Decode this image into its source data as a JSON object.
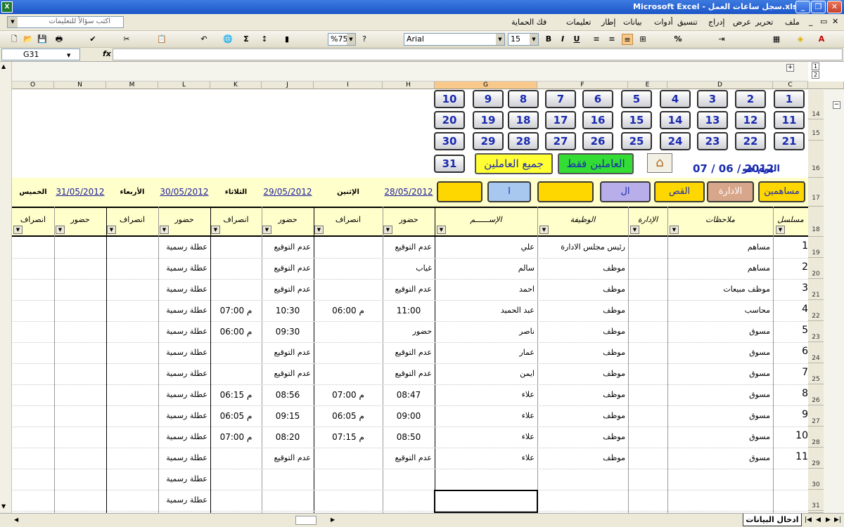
{
  "window": {
    "title": "Microsoft Excel - سجل ساعات العمل.xls"
  },
  "menu": {
    "help_placeholder": "اكتب سؤالاً للتعليمات",
    "items": [
      "ملف",
      "تحرير",
      "عرض",
      "إدراج",
      "تنسيق",
      "أدوات",
      "بيانات",
      "إطار",
      "تعليمات",
      "فك الحماية"
    ]
  },
  "toolbar": {
    "zoom": "%75",
    "font": "Arial",
    "size": "15"
  },
  "formula": {
    "namebox": "G31",
    "fx": "fx",
    "value": ""
  },
  "outline_levels": [
    "1",
    "2"
  ],
  "columns": [
    "C",
    "D",
    "E",
    "F",
    "G",
    "H",
    "I",
    "J",
    "K",
    "L",
    "M",
    "N",
    "O"
  ],
  "row_numbers": [
    "14",
    "15",
    "16",
    "17",
    "18",
    "19",
    "20",
    "21",
    "22",
    "23",
    "24",
    "25",
    "26",
    "27",
    "28",
    "29",
    "30",
    "31"
  ],
  "day_buttons": [
    "1",
    "2",
    "3",
    "4",
    "5",
    "6",
    "7",
    "8",
    "9",
    "10",
    "11",
    "12",
    "13",
    "14",
    "15",
    "16",
    "17",
    "18",
    "19",
    "20",
    "21",
    "22",
    "23",
    "24",
    "25",
    "26",
    "27",
    "28",
    "29",
    "30",
    "31"
  ],
  "buttons": {
    "all_workers": "جميع العاملين",
    "workers_only": "العاملين فقط"
  },
  "today": {
    "label": "اليوم هو",
    "date": "07 / 06 / 2012"
  },
  "categories": {
    "shareholders": "مساهمين",
    "admin": "الادارة",
    "sales": "القص",
    "c4": "ال",
    "c5": "ا",
    "c6": ""
  },
  "header": {
    "serial": "مسلسل",
    "notes": "ملاحظات",
    "dept": "الإدارة",
    "job": "الوظيفة",
    "name": "الإســــــم"
  },
  "days": [
    {
      "day": "الإثنين",
      "date": "28/05/2012",
      "in": "حضور",
      "out": "انصراف"
    },
    {
      "day": "الثلاثاء",
      "date": "29/05/2012",
      "in": "حضور",
      "out": "انصراف"
    },
    {
      "day": "الأربعاء",
      "date": "30/05/2012",
      "in": "حضور",
      "out": "انصراف"
    },
    {
      "day": "الخميس",
      "date": "31/05/2012",
      "in": "حضور",
      "out": "انصراف"
    }
  ],
  "rows": [
    {
      "n": "1",
      "notes": "مساهم",
      "job": "رئيس مجلس الادارة",
      "name": "علي",
      "in1": "عدم التوقيع",
      "out1": "",
      "in2": "عدم التوقيع",
      "out2": "",
      "in3": "عطلة رسمية"
    },
    {
      "n": "2",
      "notes": "مساهم",
      "job": "موظف",
      "name": "سالم",
      "in1": "غياب",
      "out1": "",
      "in2": "عدم التوقيع",
      "out2": "",
      "in3": "عطلة رسمية"
    },
    {
      "n": "3",
      "notes": "موظف مبيعات",
      "job": "موظف",
      "name": "احمد",
      "in1": "عدم التوقيع",
      "out1": "",
      "in2": "عدم التوقيع",
      "out2": "",
      "in3": "عطلة رسمية"
    },
    {
      "n": "4",
      "notes": "محاسب",
      "job": "موظف",
      "name": "عبد الحميد",
      "in1": "11:00",
      "out1": "06:00 م",
      "in2": "10:30",
      "out2": "07:00 م",
      "in3": "عطلة رسمية"
    },
    {
      "n": "5",
      "notes": "مسوق",
      "job": "موظف",
      "name": "ناصر",
      "in1": "حضور",
      "out1": "",
      "in2": "09:30",
      "out2": "06:00 م",
      "in3": "عطلة رسمية"
    },
    {
      "n": "6",
      "notes": "مسوق",
      "job": "موظف",
      "name": "عمار",
      "in1": "عدم التوقيع",
      "out1": "",
      "in2": "عدم التوقيع",
      "out2": "",
      "in3": "عطلة رسمية"
    },
    {
      "n": "7",
      "notes": "مسوق",
      "job": "موظف",
      "name": "ايمن",
      "in1": "عدم التوقيع",
      "out1": "",
      "in2": "عدم التوقيع",
      "out2": "",
      "in3": "عطلة رسمية"
    },
    {
      "n": "8",
      "notes": "مسوق",
      "job": "موظف",
      "name": "علاء",
      "in1": "08:47",
      "out1": "07:00 م",
      "in2": "08:56",
      "out2": "06:15 م",
      "in3": "عطلة رسمية"
    },
    {
      "n": "9",
      "notes": "مسوق",
      "job": "موظف",
      "name": "علاء",
      "in1": "09:00",
      "out1": "06:05 م",
      "in2": "09:15",
      "out2": "06:05 م",
      "in3": "عطلة رسمية"
    },
    {
      "n": "10",
      "notes": "مسوق",
      "job": "موظف",
      "name": "علاء",
      "in1": "08:50",
      "out1": "07:15 م",
      "in2": "08:20",
      "out2": "07:00 م",
      "in3": "عطلة رسمية"
    },
    {
      "n": "11",
      "notes": "مسوق",
      "job": "موظف",
      "name": "علاء",
      "in1": "عدم التوقيع",
      "out1": "",
      "in2": "عدم التوقيع",
      "out2": "",
      "in3": "عطلة رسمية"
    },
    {
      "n": "",
      "notes": "",
      "job": "",
      "name": "",
      "in1": "",
      "out1": "",
      "in2": "",
      "out2": "",
      "in3": "عطلة رسمية"
    },
    {
      "n": "",
      "notes": "",
      "job": "",
      "name": "",
      "in1": "",
      "out1": "",
      "in2": "",
      "out2": "",
      "in3": "عطلة رسمية"
    }
  ],
  "sheet_tab": "ادخال البيانات",
  "colors": {
    "accent": "#f8c98a",
    "title": "#1c55c8",
    "digit": "#1a2bb0"
  }
}
